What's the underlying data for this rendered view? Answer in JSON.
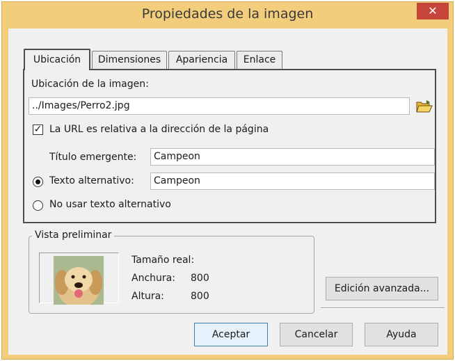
{
  "window": {
    "title": "Propiedades de la imagen",
    "close_glyph": "✕"
  },
  "tabs": [
    {
      "label": "Ubicación",
      "active": true
    },
    {
      "label": "Dimensiones",
      "active": false
    },
    {
      "label": "Apariencia",
      "active": false
    },
    {
      "label": "Enlace",
      "active": false
    }
  ],
  "location": {
    "image_label": "Ubicación de la imagen:",
    "image_path": "../Images/Perro2.jpg",
    "browse_icon": "folder-open-icon",
    "relative_url_checked": true,
    "relative_url_label": "La URL es relativa a la dirección de la página",
    "tooltip_label": "Título emergente:",
    "tooltip_value": "Campeon",
    "alt_text_selected": true,
    "alt_text_label": "Texto alternativo:",
    "alt_text_value": "Campeon",
    "no_alt_label": "No usar texto alternativo"
  },
  "preview": {
    "legend": "Vista preliminar",
    "real_size_label": "Tamaño real:",
    "width_label": "Anchura:",
    "width_value": "800",
    "height_label": "Altura:",
    "height_value": "800"
  },
  "buttons": {
    "advanced": "Edición avanzada...",
    "accept": "Aceptar",
    "cancel": "Cancelar",
    "help": "Ayuda"
  },
  "colors": {
    "titlebar": "#f2cd7b",
    "close": "#c7463b",
    "client": "#f0f0f0"
  }
}
